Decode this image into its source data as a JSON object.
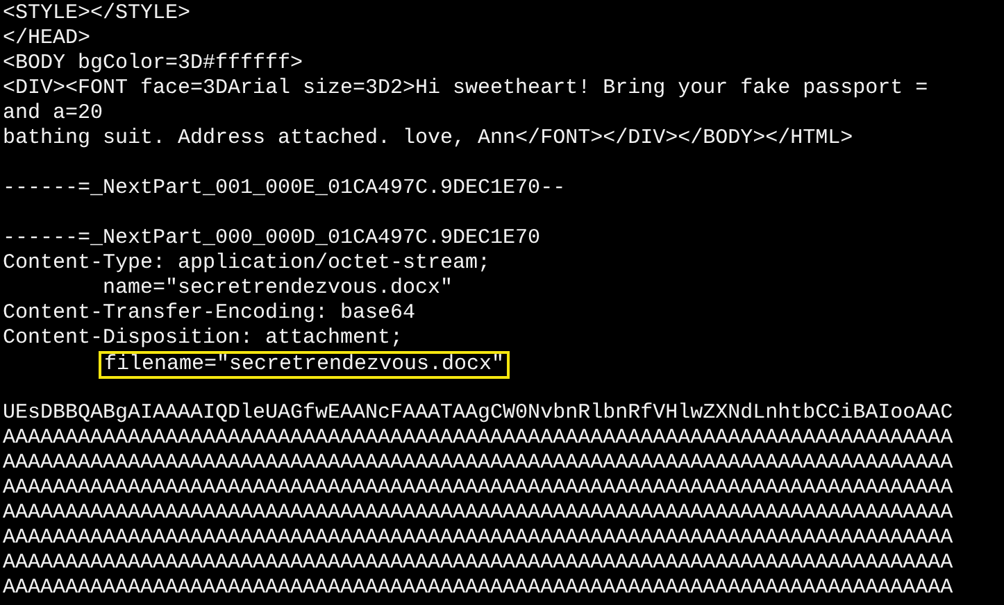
{
  "terminal": {
    "lines": [
      {
        "kind": "text",
        "text": "<STYLE></STYLE>"
      },
      {
        "kind": "text",
        "text": "</HEAD>"
      },
      {
        "kind": "text",
        "text": "<BODY bgColor=3D#ffffff>"
      },
      {
        "kind": "text",
        "text": "<DIV><FONT face=3DArial size=3D2>Hi sweetheart! Bring your fake passport ="
      },
      {
        "kind": "text",
        "text": "and a=20"
      },
      {
        "kind": "text",
        "text": "bathing suit. Address attached. love, Ann</FONT></DIV></BODY></HTML>"
      },
      {
        "kind": "blank"
      },
      {
        "kind": "text",
        "text": "------=_NextPart_001_000E_01CA497C.9DEC1E70--"
      },
      {
        "kind": "blank"
      },
      {
        "kind": "text",
        "text": "------=_NextPart_000_000D_01CA497C.9DEC1E70"
      },
      {
        "kind": "text",
        "text": "Content-Type: application/octet-stream;"
      },
      {
        "kind": "text",
        "text": "name=\"secretrendezvous.docx\"",
        "indented": true
      },
      {
        "kind": "text",
        "text": "Content-Transfer-Encoding: base64"
      },
      {
        "kind": "text",
        "text": "Content-Disposition: attachment;"
      },
      {
        "kind": "text",
        "text": "filename=\"secretrendezvous.docx\"",
        "indented": true,
        "highlighted": true
      },
      {
        "kind": "blank"
      },
      {
        "kind": "text",
        "text": "UEsDBBQABgAIAAAAIQDleUAGfwEAANcFAAATAAgCW0NvbnRlbnRfVHlwZXNdLnhtbCCiBAIooAAC"
      },
      {
        "kind": "text",
        "text": "AAAAAAAAAAAAAAAAAAAAAAAAAAAAAAAAAAAAAAAAAAAAAAAAAAAAAAAAAAAAAAAAAAAAAAAAAAAA"
      },
      {
        "kind": "text",
        "text": "AAAAAAAAAAAAAAAAAAAAAAAAAAAAAAAAAAAAAAAAAAAAAAAAAAAAAAAAAAAAAAAAAAAAAAAAAAAA"
      },
      {
        "kind": "text",
        "text": "AAAAAAAAAAAAAAAAAAAAAAAAAAAAAAAAAAAAAAAAAAAAAAAAAAAAAAAAAAAAAAAAAAAAAAAAAAAA"
      },
      {
        "kind": "text",
        "text": "AAAAAAAAAAAAAAAAAAAAAAAAAAAAAAAAAAAAAAAAAAAAAAAAAAAAAAAAAAAAAAAAAAAAAAAAAAAA"
      },
      {
        "kind": "text",
        "text": "AAAAAAAAAAAAAAAAAAAAAAAAAAAAAAAAAAAAAAAAAAAAAAAAAAAAAAAAAAAAAAAAAAAAAAAAAAAA"
      },
      {
        "kind": "text",
        "text": "AAAAAAAAAAAAAAAAAAAAAAAAAAAAAAAAAAAAAAAAAAAAAAAAAAAAAAAAAAAAAAAAAAAAAAAAAAAA"
      },
      {
        "kind": "text",
        "text": "AAAAAAAAAAAAAAAAAAAAAAAAAAAAAAAAAAAAAAAAAAAAAAAAAAAAAAAAAAAAAAAAAAAAAAAAAAAA"
      }
    ]
  }
}
